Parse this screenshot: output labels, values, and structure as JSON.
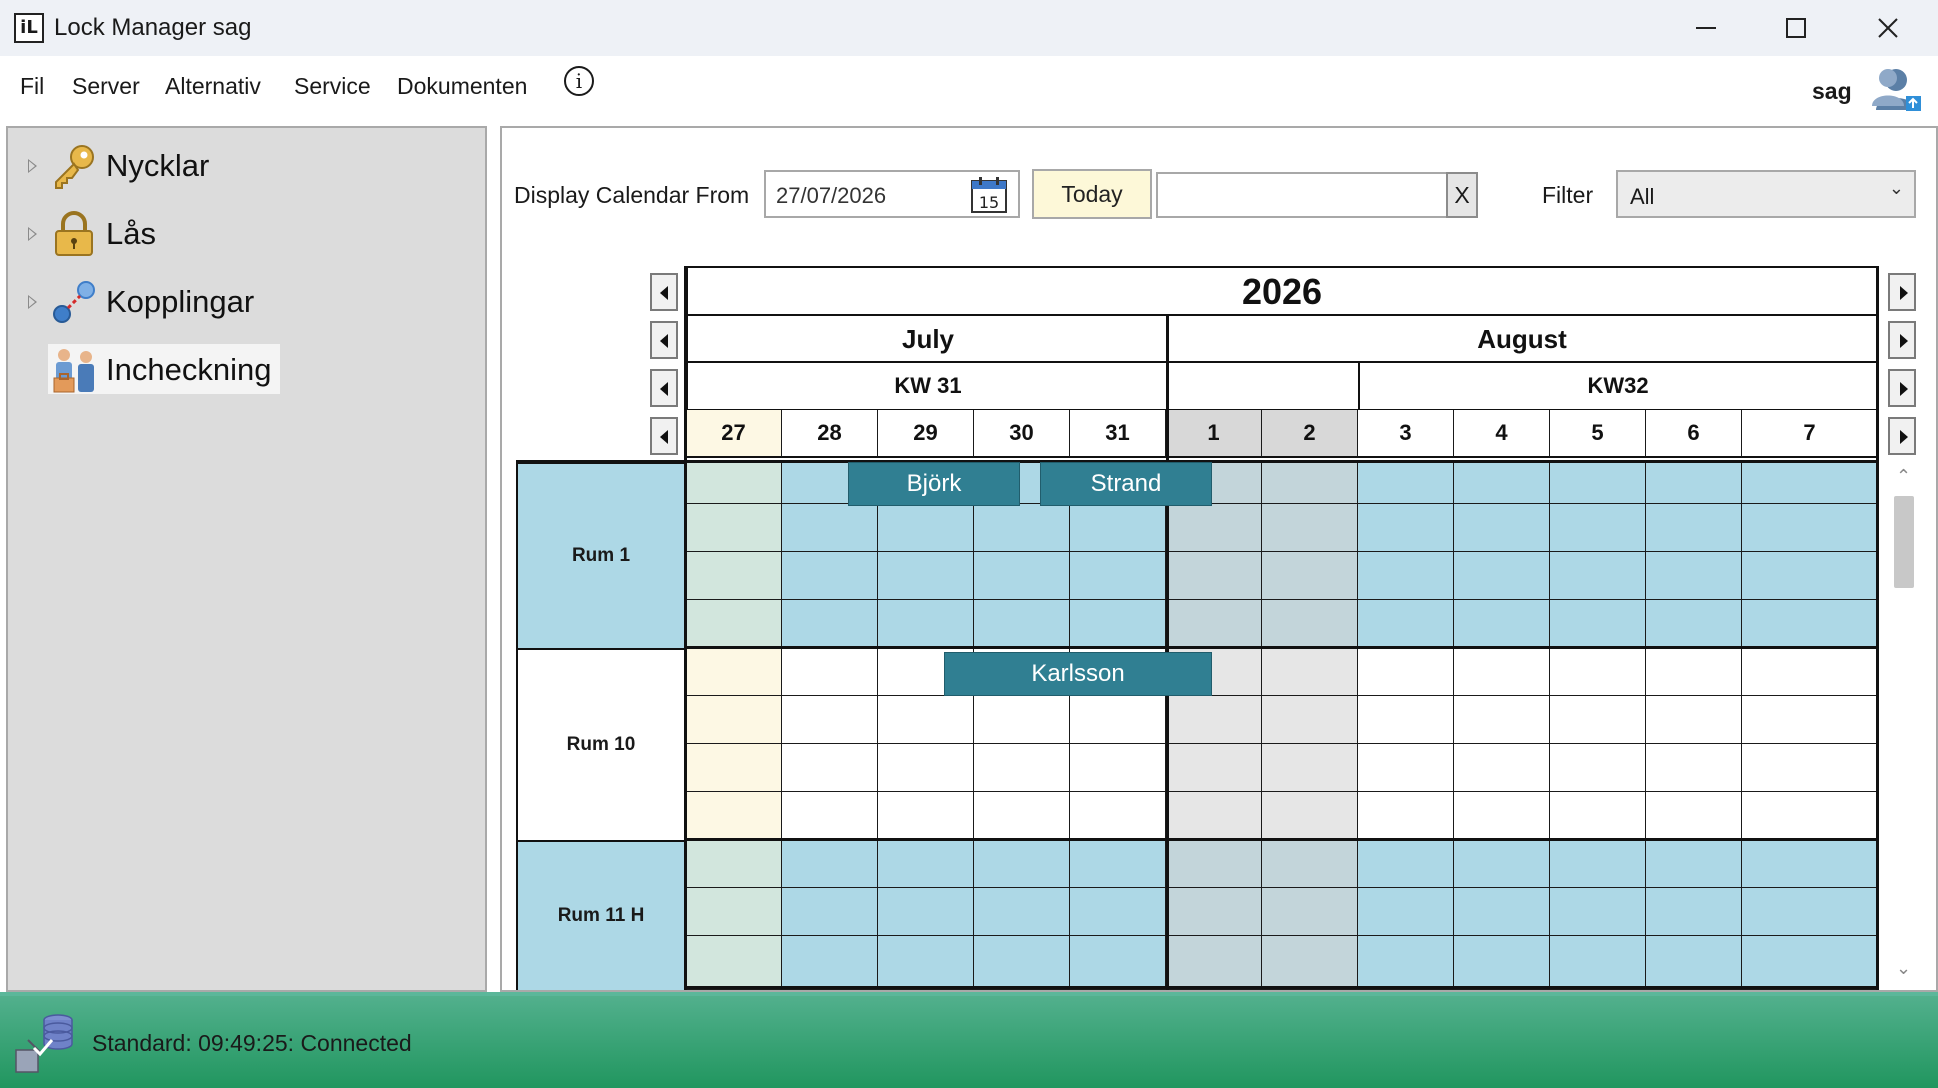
{
  "window": {
    "title": "Lock Manager sag"
  },
  "menu": {
    "items": [
      "Fil",
      "Server",
      "Alternativ",
      "Service",
      "Dokumenten"
    ],
    "info_icon": "info-icon",
    "user": "sag"
  },
  "tree": {
    "items": [
      {
        "label": "Nycklar",
        "icon": "key-icon",
        "expandable": true
      },
      {
        "label": "Lås",
        "icon": "lock-icon",
        "expandable": true
      },
      {
        "label": "Kopplingar",
        "icon": "link-icon",
        "expandable": true
      },
      {
        "label": "Incheckning",
        "icon": "checkin-icon",
        "expandable": false,
        "selected": true
      }
    ]
  },
  "toolbar": {
    "display_from_label": "Display Calendar From",
    "date_value": "27/07/2026",
    "calendar_day": "15",
    "today_label": "Today",
    "search_value": "",
    "clear_label": "X",
    "filter_label": "Filter",
    "filter_value": "All"
  },
  "calendar": {
    "year": "2026",
    "months": [
      "July",
      "August"
    ],
    "weeks": [
      "KW 31",
      "",
      "KW32"
    ],
    "days": [
      "27",
      "28",
      "29",
      "30",
      "31",
      "1",
      "2",
      "3",
      "4",
      "5",
      "6",
      "7"
    ],
    "rooms": [
      "Rum 1",
      "Rum 10",
      "Rum 11 H"
    ],
    "bookings": [
      {
        "room": "Rum 1",
        "guest": "Björk"
      },
      {
        "room": "Rum 1",
        "guest": "Strand"
      },
      {
        "room": "Rum 10",
        "guest": "Karlsson"
      }
    ],
    "colors": {
      "occupied": "#add8e6",
      "booking": "#307f92",
      "weekend": "#c3d5da",
      "today": "#fdf8e4"
    }
  },
  "status": {
    "text": "Standard: 09:49:25: Connected"
  }
}
